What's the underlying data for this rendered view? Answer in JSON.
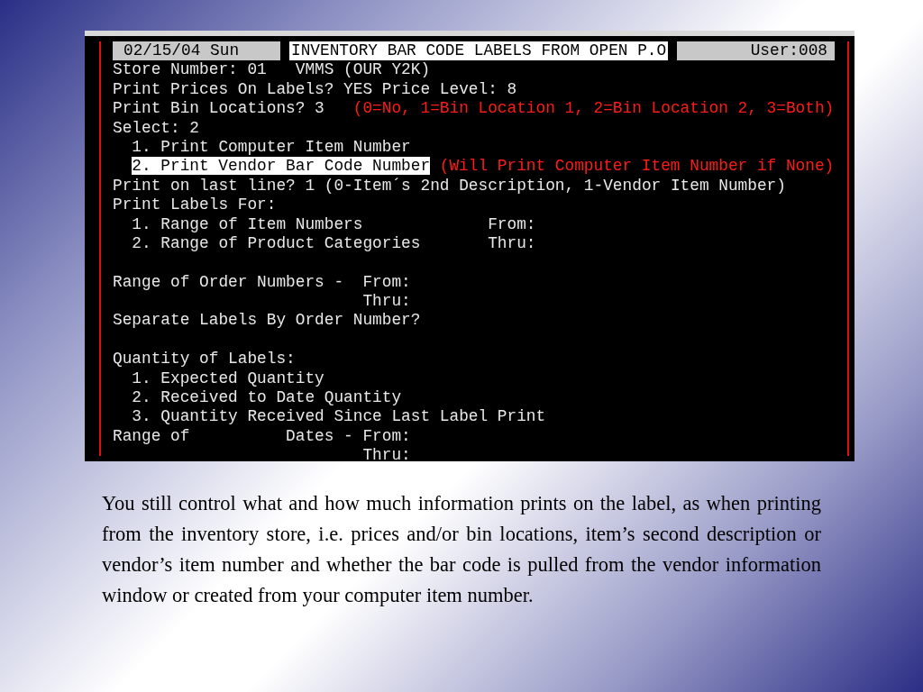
{
  "terminal": {
    "header": {
      "date": "02/15/04 Sun",
      "title": "INVENTORY BAR CODE LABELS FROM OPEN P.O",
      "user": "User:008"
    },
    "lines": [
      {
        "kind": "text",
        "segments": [
          {
            "kind": "normal",
            "text": "Store Number: 01   VMMS (OUR Y2K)"
          }
        ]
      },
      {
        "kind": "text",
        "segments": [
          {
            "kind": "normal",
            "text": "Print Prices On Labels? YES Price Level: 8"
          }
        ]
      },
      {
        "kind": "text",
        "segments": [
          {
            "kind": "normal",
            "text": "Print Bin Locations? 3"
          },
          {
            "kind": "note",
            "text": "(0=No, 1=Bin Location 1, 2=Bin Location 2, 3=Both)"
          }
        ]
      },
      {
        "kind": "text",
        "segments": [
          {
            "kind": "normal",
            "text": "Select: 2"
          }
        ]
      },
      {
        "kind": "text",
        "segments": [
          {
            "kind": "normal",
            "text": "  1. Print Computer Item Number"
          }
        ]
      },
      {
        "kind": "indented",
        "segments": [
          {
            "kind": "highlight",
            "text": "2. Print Vendor Bar Code Number"
          },
          {
            "kind": "note",
            "text": "(Will Print Computer Item Number if None)"
          }
        ]
      },
      {
        "kind": "text",
        "segments": [
          {
            "kind": "normal",
            "text": "Print on last line? 1 (0-Item´s 2nd Description, 1-Vendor Item Number)"
          }
        ]
      },
      {
        "kind": "text",
        "segments": [
          {
            "kind": "normal",
            "text": "Print Labels For:"
          }
        ]
      },
      {
        "kind": "text",
        "segments": [
          {
            "kind": "normal",
            "text": "  1. Range of Item Numbers             From:"
          }
        ]
      },
      {
        "kind": "text",
        "segments": [
          {
            "kind": "normal",
            "text": "  2. Range of Product Categories       Thru:"
          }
        ]
      },
      {
        "kind": "blank"
      },
      {
        "kind": "text",
        "segments": [
          {
            "kind": "normal",
            "text": "Range of Order Numbers -  From:"
          }
        ]
      },
      {
        "kind": "text",
        "segments": [
          {
            "kind": "normal",
            "text": "                          Thru:"
          }
        ]
      },
      {
        "kind": "text",
        "segments": [
          {
            "kind": "normal",
            "text": "Separate Labels By Order Number?"
          }
        ]
      },
      {
        "kind": "blank"
      },
      {
        "kind": "text",
        "segments": [
          {
            "kind": "normal",
            "text": "Quantity of Labels:"
          }
        ]
      },
      {
        "kind": "text",
        "segments": [
          {
            "kind": "normal",
            "text": "  1. Expected Quantity"
          }
        ]
      },
      {
        "kind": "text",
        "segments": [
          {
            "kind": "normal",
            "text": "  2. Received to Date Quantity"
          }
        ]
      },
      {
        "kind": "text",
        "segments": [
          {
            "kind": "normal",
            "text": "  3. Quantity Received Since Last Label Print"
          }
        ]
      },
      {
        "kind": "text",
        "segments": [
          {
            "kind": "normal",
            "text": "Range of          Dates - From:"
          }
        ]
      },
      {
        "kind": "text",
        "segments": [
          {
            "kind": "normal",
            "text": "                          Thru:"
          }
        ]
      }
    ]
  },
  "caption": "You still control what and how much information prints on the label, as when printing from the inventory store, i.e. prices and/or bin locations, item’s second description or vendor’s item number and whether the bar code is pulled from the vendor information window or created from your computer item number."
}
